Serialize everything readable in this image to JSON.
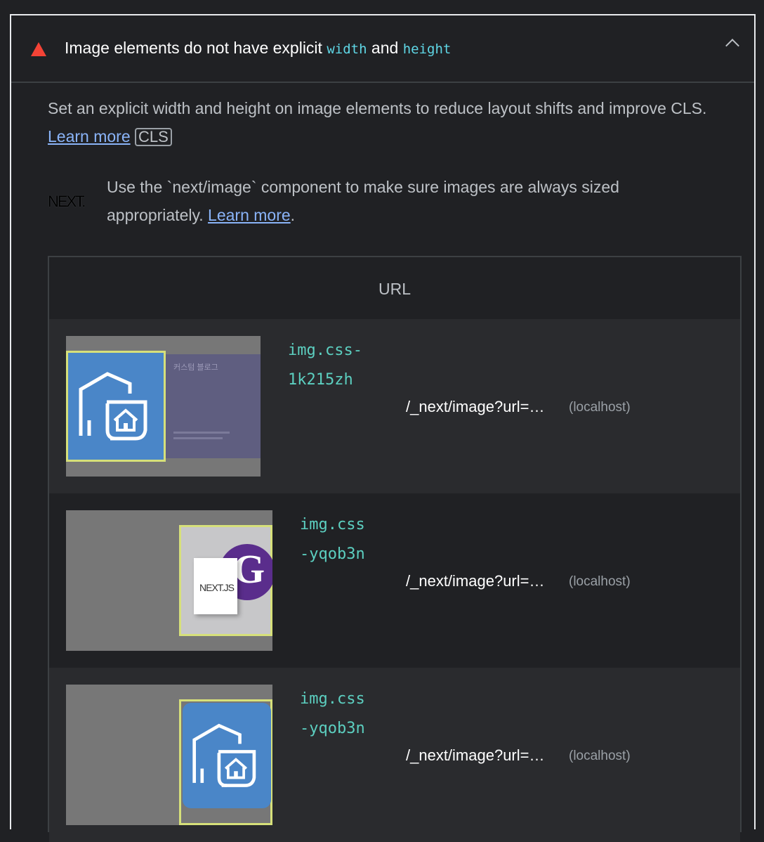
{
  "audit": {
    "title_prefix": "Image elements do not have explicit ",
    "code_width": "width",
    "title_mid": " and ",
    "code_height": "height",
    "description": "Set an explicit width and height on image elements to reduce layout shifts and improve CLS. ",
    "learn_more": "Learn more",
    "tag": "CLS",
    "stack_pack_logo": "NEXT.",
    "stack_pack_text": "Use the `next/image` component to make sure images are always sized appropriately. ",
    "stack_pack_learn_more": "Learn more",
    "stack_pack_period": "."
  },
  "table": {
    "header": "URL",
    "rows": [
      {
        "node_line1": "img.css-",
        "node_line2": "1k215zh",
        "url": "/_next/image?url=…",
        "host": "(localhost)",
        "thumb_text_title": "커스텀 블로그"
      },
      {
        "node_line1": "img.css",
        "node_line2": "-yqob3n",
        "url": "/_next/image?url=…",
        "host": "(localhost)",
        "thumb_logo": "NEXT.JS",
        "thumb_letter": "G"
      },
      {
        "node_line1": "img.css",
        "node_line2": "-yqob3n",
        "url": "/_next/image?url=…",
        "host": "(localhost)"
      }
    ]
  },
  "colors": {
    "fail": "#f44336",
    "link": "#8ab4f8",
    "node": "#5ccfc0",
    "highlight": "#d6e07a",
    "logo_blue": "#4a86c8"
  },
  "icons": {
    "status": "warning-triangle-icon",
    "toggle": "chevron-up-icon"
  }
}
